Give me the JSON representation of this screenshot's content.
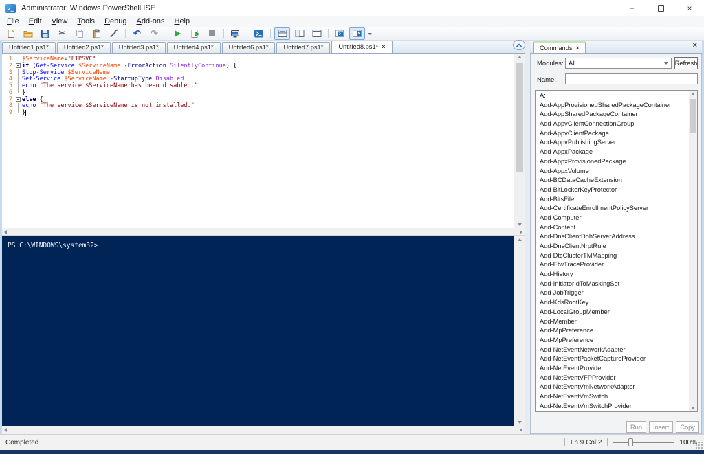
{
  "window": {
    "title": "Administrator: Windows PowerShell ISE"
  },
  "menu": {
    "items": [
      "File",
      "Edit",
      "View",
      "Tools",
      "Debug",
      "Add-ons",
      "Help"
    ]
  },
  "tabs": [
    "Untitled1.ps1*",
    "Untitled2.ps1*",
    "Untitled3.ps1*",
    "Untitled4.ps1*",
    "Untitled6.ps1*",
    "Untitled7.ps1*",
    "Untitled8.ps1*"
  ],
  "active_tab_index": 6,
  "editor": {
    "colors": {
      "variable": "#FF4500",
      "string": "#8B0000",
      "keyword": "#00008B",
      "cmdlet": "#0000FF",
      "parameter": "#000080",
      "argument": "#8A2BE2",
      "plain": "#000000",
      "line_number": "#C5803C"
    },
    "lines": [
      {
        "n": 1,
        "fold": "",
        "tokens": [
          [
            "v",
            "$ServiceName"
          ],
          [
            "p",
            "="
          ],
          [
            "s",
            "\"FTPSVC\""
          ]
        ]
      },
      {
        "n": 2,
        "fold": "box",
        "tokens": [
          [
            "k",
            "if"
          ],
          [
            "p",
            " ("
          ],
          [
            "c",
            "Get-Service"
          ],
          [
            "p",
            " "
          ],
          [
            "v",
            "$ServiceName"
          ],
          [
            "p",
            " "
          ],
          [
            "m",
            "-ErrorAction"
          ],
          [
            "p",
            " "
          ],
          [
            "a",
            "SilentlyContinue"
          ],
          [
            "p",
            ") {"
          ]
        ]
      },
      {
        "n": 3,
        "fold": "line",
        "tokens": [
          [
            "c",
            "Stop-Service"
          ],
          [
            "p",
            " "
          ],
          [
            "v",
            "$ServiceName"
          ]
        ]
      },
      {
        "n": 4,
        "fold": "line",
        "tokens": [
          [
            "c",
            "Set-Service"
          ],
          [
            "p",
            " "
          ],
          [
            "v",
            "$ServiceName"
          ],
          [
            "p",
            " "
          ],
          [
            "m",
            "-StartupType"
          ],
          [
            "p",
            " "
          ],
          [
            "a",
            "Disabled"
          ]
        ]
      },
      {
        "n": 5,
        "fold": "line",
        "tokens": [
          [
            "c",
            "echo"
          ],
          [
            "p",
            " "
          ],
          [
            "s",
            "\"The service $ServiceName has been disabled.\""
          ]
        ]
      },
      {
        "n": 6,
        "fold": "end",
        "tokens": [
          [
            "p",
            "}"
          ]
        ]
      },
      {
        "n": 7,
        "fold": "box",
        "tokens": [
          [
            "k",
            "else"
          ],
          [
            "p",
            " {"
          ]
        ]
      },
      {
        "n": 8,
        "fold": "line",
        "tokens": [
          [
            "c",
            "echo"
          ],
          [
            "p",
            " "
          ],
          [
            "s",
            "\"The service $ServiceName is not installed.\""
          ]
        ]
      },
      {
        "n": 9,
        "fold": "end",
        "tokens": [
          [
            "p",
            "}"
          ]
        ],
        "caret": true
      }
    ]
  },
  "console": {
    "prompt": "PS C:\\WINDOWS\\system32>",
    "bg": "#012456"
  },
  "commands": {
    "tab_label": "Commands",
    "modules_label": "Modules:",
    "modules_value": "All",
    "refresh_label": "Refresh",
    "name_label": "Name:",
    "name_value": "",
    "list": [
      "A:",
      "Add-AppProvisionedSharedPackageContainer",
      "Add-AppSharedPackageContainer",
      "Add-AppvClientConnectionGroup",
      "Add-AppvClientPackage",
      "Add-AppvPublishingServer",
      "Add-AppxPackage",
      "Add-AppxProvisionedPackage",
      "Add-AppxVolume",
      "Add-BCDataCacheExtension",
      "Add-BitLockerKeyProtector",
      "Add-BitsFile",
      "Add-CertificateEnrollmentPolicyServer",
      "Add-Computer",
      "Add-Content",
      "Add-DnsClientDohServerAddress",
      "Add-DnsClientNrptRule",
      "Add-DtcClusterTMMapping",
      "Add-EtwTraceProvider",
      "Add-History",
      "Add-InitiatorIdToMaskingSet",
      "Add-JobTrigger",
      "Add-KdsRootKey",
      "Add-LocalGroupMember",
      "Add-Member",
      "Add-MpPreference",
      "Add-MpPreference",
      "Add-NetEventNetworkAdapter",
      "Add-NetEventPacketCaptureProvider",
      "Add-NetEventProvider",
      "Add-NetEventVFPProvider",
      "Add-NetEventVmNetworkAdapter",
      "Add-NetEventVmSwitch",
      "Add-NetEventVmSwitchProvider"
    ],
    "buttons": [
      "Run",
      "Insert",
      "Copy"
    ]
  },
  "status": {
    "left": "Completed",
    "line_col": "Ln 9 Col 2",
    "zoom_value": "100%"
  }
}
